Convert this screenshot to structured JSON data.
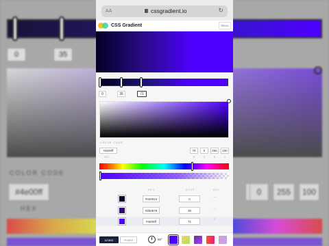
{
  "background": {
    "stop_inputs": [
      "0",
      "35"
    ],
    "label_color": "COLOR CODE",
    "hex": "#4e00ff",
    "hex_sub": "HEX",
    "rgba_values": [
      "78",
      "0",
      "255",
      "100"
    ]
  },
  "browser": {
    "text_size_label": "AA",
    "url": "cssgradient.io"
  },
  "site": {
    "brand": "CSS Gradient",
    "menu_label": "Menu"
  },
  "gradient": {
    "stop_positions": [
      "0",
      "35",
      "71"
    ],
    "active_stop_index": 2
  },
  "picker": {
    "color_code_label": "COLOR CODE",
    "hex_value": "#4e00ff",
    "hex_sub_label": "HEX",
    "rgba": [
      {
        "value": "78",
        "label": "R"
      },
      {
        "value": "0",
        "label": "G"
      },
      {
        "value": "255",
        "label": "B"
      },
      {
        "value": "100",
        "label": "A"
      }
    ]
  },
  "stops_table": {
    "headers": {
      "hex": "HEX",
      "stop": "STOP",
      "delete": "DEL"
    },
    "rows": [
      {
        "hex": "#020024",
        "stop": "0",
        "color": "#020024"
      },
      {
        "hex": "#2b0979",
        "stop": "35",
        "color": "#2b0979"
      },
      {
        "hex": "#4e00ff",
        "stop": "71",
        "color": "#4e00ff"
      }
    ]
  },
  "toolbar": {
    "linear_label": "Linear",
    "radial_label": "Radial",
    "angle": "90°",
    "presets": [
      "#4e00ff",
      "#a8e063",
      "#8e44ad",
      "#ff512f",
      "#c9a3e0"
    ]
  },
  "colors": {
    "accent": "#4e00ff",
    "dark_stop": "#020024",
    "mid_stop": "#2b0979"
  }
}
